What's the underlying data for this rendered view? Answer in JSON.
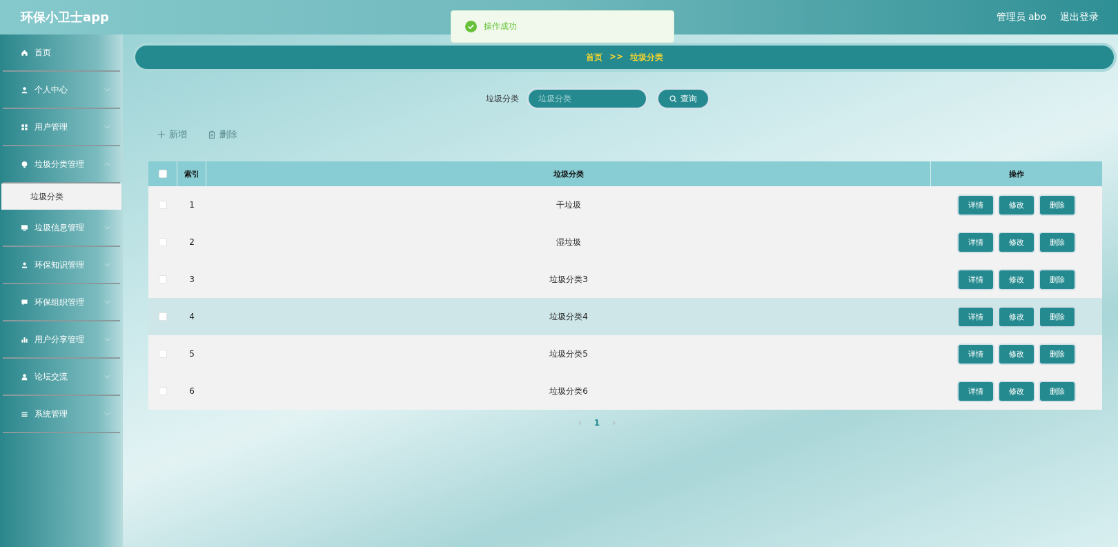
{
  "header": {
    "title": "环保小卫士app",
    "user": "管理员 abo",
    "logout": "退出登录"
  },
  "toast": {
    "message": "操作成功"
  },
  "sidebar": {
    "items": [
      {
        "label": "首页",
        "expandable": false,
        "expanded": false
      },
      {
        "label": "个人中心",
        "expandable": true,
        "expanded": false
      },
      {
        "label": "用户管理",
        "expandable": true,
        "expanded": false
      },
      {
        "label": "垃圾分类管理",
        "expandable": true,
        "expanded": true,
        "children": [
          {
            "label": "垃圾分类",
            "selected": true
          }
        ]
      },
      {
        "label": "垃圾信息管理",
        "expandable": true,
        "expanded": false
      },
      {
        "label": "环保知识管理",
        "expandable": true,
        "expanded": false
      },
      {
        "label": "环保组织管理",
        "expandable": true,
        "expanded": false
      },
      {
        "label": "用户分享管理",
        "expandable": true,
        "expanded": false
      },
      {
        "label": "论坛交流",
        "expandable": true,
        "expanded": false
      },
      {
        "label": "系统管理",
        "expandable": true,
        "expanded": false
      }
    ]
  },
  "breadcrumb": [
    "首页",
    "垃圾分类"
  ],
  "breadcrumb_separator": ">>",
  "search": {
    "label": "垃圾分类",
    "placeholder": "垃圾分类",
    "button": "查询"
  },
  "actions": [
    {
      "label": "新增",
      "kind": "add"
    },
    {
      "label": "删除",
      "kind": "delete"
    }
  ],
  "table": {
    "select_all_checked": false,
    "columns": [
      "索引",
      "垃圾分类",
      "操作"
    ],
    "rows": [
      {
        "index": "1",
        "name": "干垃圾",
        "checked": false,
        "highlighted": false,
        "buttons": [
          "详情",
          "修改",
          "删除"
        ]
      },
      {
        "index": "2",
        "name": "湿垃圾",
        "checked": false,
        "highlighted": false,
        "buttons": [
          "详情",
          "修改",
          "删除"
        ]
      },
      {
        "index": "3",
        "name": "垃圾分类3",
        "checked": false,
        "highlighted": false,
        "buttons": [
          "详情",
          "修改",
          "删除"
        ]
      },
      {
        "index": "4",
        "name": "垃圾分类4",
        "checked": false,
        "highlighted": true,
        "buttons": [
          "详情",
          "修改",
          "删除"
        ]
      },
      {
        "index": "5",
        "name": "垃圾分类5",
        "checked": false,
        "highlighted": false,
        "buttons": [
          "详情",
          "修改",
          "删除"
        ]
      },
      {
        "index": "6",
        "name": "垃圾分类6",
        "checked": false,
        "highlighted": false,
        "buttons": [
          "详情",
          "修改",
          "删除"
        ]
      }
    ]
  },
  "pagination": {
    "prev": "‹",
    "next": "›",
    "pages": [
      {
        "label": "1",
        "selected": true
      }
    ]
  }
}
